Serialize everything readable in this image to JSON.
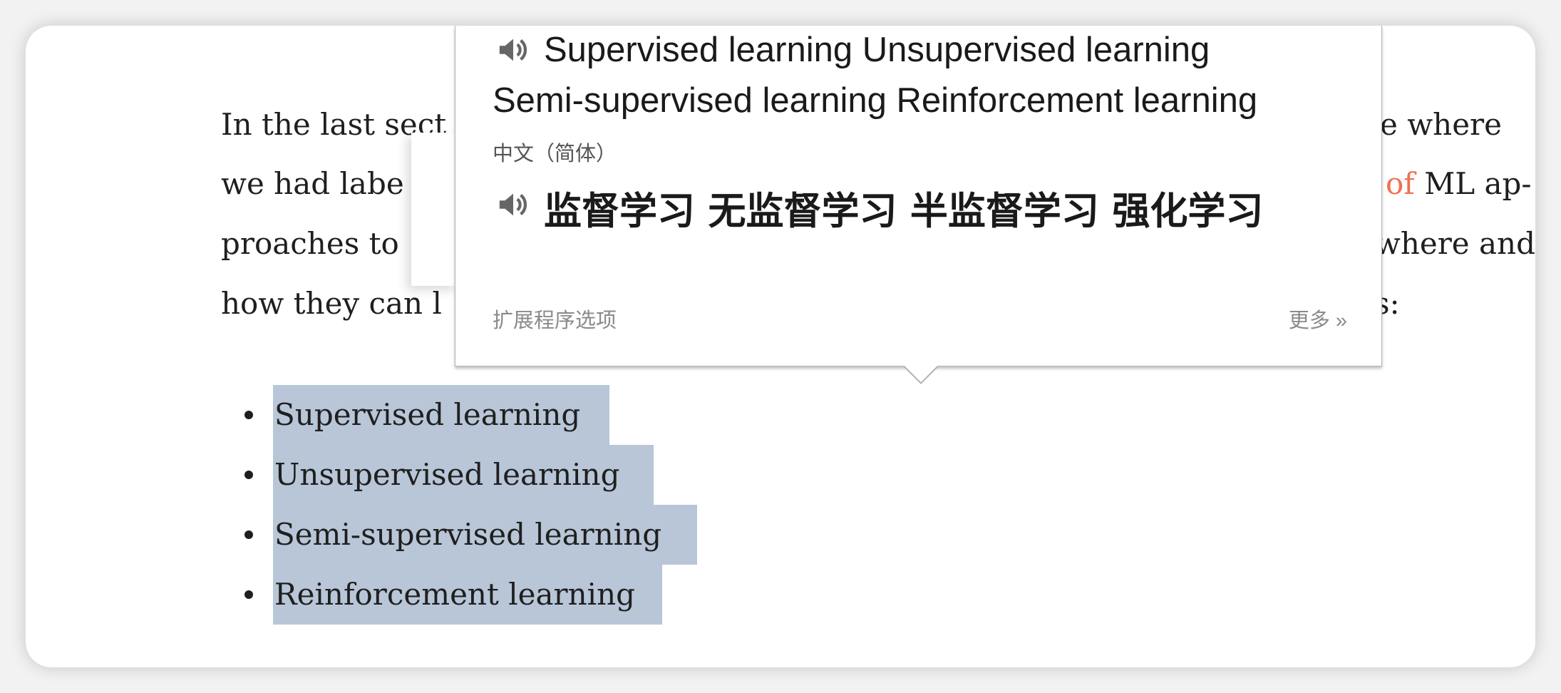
{
  "paragraph": {
    "left_fragments": [
      "In the last sect",
      "we had labe",
      "proaches to",
      "how they can l"
    ],
    "right_fragments": {
      "line1": "e where",
      "line2_link": "of",
      "line2_rest": " ML ap-",
      "line3": "where and",
      "line4": "s:"
    }
  },
  "list": {
    "items": [
      "Supervised learning",
      "Unsupervised learning",
      "Semi-supervised learning",
      "Reinforcement learning"
    ]
  },
  "popup": {
    "source_line1": "Supervised learning Unsupervised learning",
    "source_line2": "Semi-supervised learning Reinforcement learning",
    "target_language": "中文（简体）",
    "translation": "监督学习 无监督学习 半监督学习 强化学习",
    "options_link": "扩展程序选项",
    "more_link": "更多 »"
  },
  "colors": {
    "highlight": "#b8c6d8",
    "link": "#f0704f"
  }
}
